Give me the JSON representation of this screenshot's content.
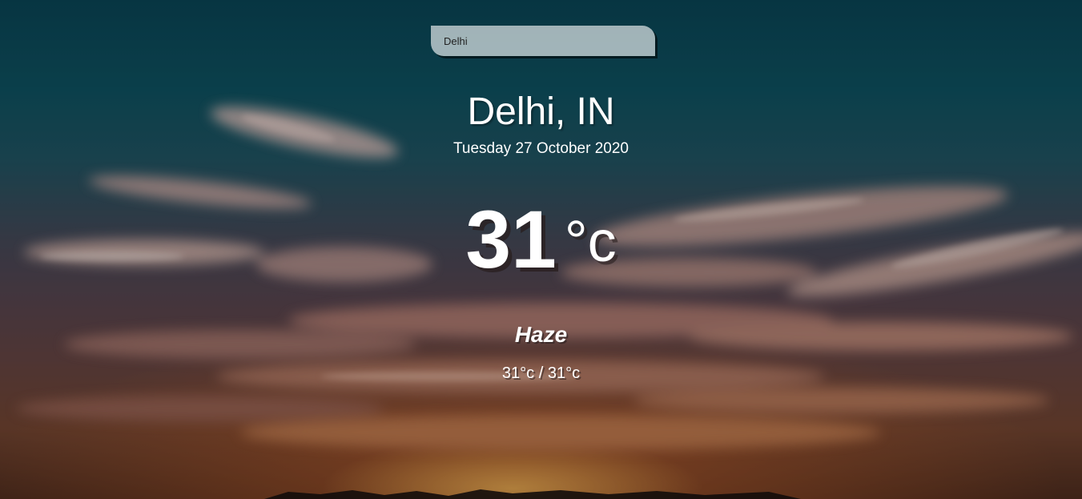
{
  "search": {
    "value": "Delhi",
    "placeholder": ""
  },
  "location": {
    "city_country": "Delhi, IN",
    "date": "Tuesday 27 October 2020"
  },
  "current": {
    "temperature": "31",
    "unit": "°c",
    "condition": "Haze",
    "hi_lo": "31°c / 31°c"
  },
  "colors": {
    "text": "#ffffff",
    "search_bg": "#b8c8cc"
  }
}
